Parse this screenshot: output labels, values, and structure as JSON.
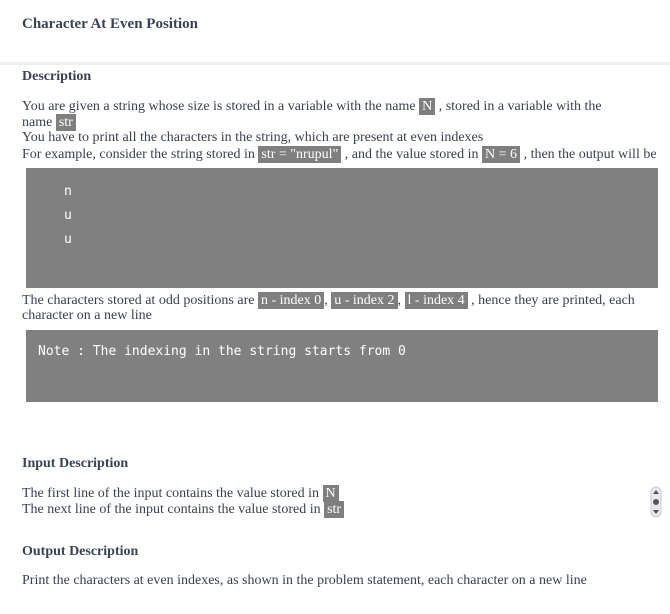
{
  "title": "Character At Even Position",
  "description": {
    "heading": "Description",
    "l1_text": "You are given a string whose size is stored in a variable with the name",
    "l1_chip": "N",
    "l1_after": ", stored in a variable with the",
    "l2_text": "name",
    "l2_chip": "str",
    "l3_text": "You have to print all the characters in the string, which are present at even indexes",
    "l4_text1": "For example, consider the string stored in",
    "l4_chip1": "str = \"nrupul\"",
    "l4_text2": ", and the value stored in",
    "l4_chip2": "N = 6",
    "l4_text3": ", then the output will be"
  },
  "output_example": [
    "n",
    "u",
    "u"
  ],
  "explanation": {
    "text1": "The characters stored at odd positions are",
    "chip1": "n - index 0",
    "sep1": ",",
    "chip2": "u - index 2",
    "sep2": ",",
    "chip3": "l - index 4",
    "text2": ", hence they are printed, each",
    "line2": "character on a new line"
  },
  "note": "Note : The indexing in the string starts from 0",
  "input_description": {
    "heading": "Input Description",
    "l1_text": "The first line of the input contains the value stored in",
    "l1_chip": "N",
    "l2_text": "The next line of the input contains the value stored in",
    "l2_chip": "str"
  },
  "output_description": {
    "heading": "Output Description",
    "text": "Print the characters at even indexes, as shown in the problem statement, each character on a new line"
  },
  "colors": {
    "chip_bg": "#7f7f7f",
    "code_bg": "#808080",
    "heading": "#3b4258"
  }
}
